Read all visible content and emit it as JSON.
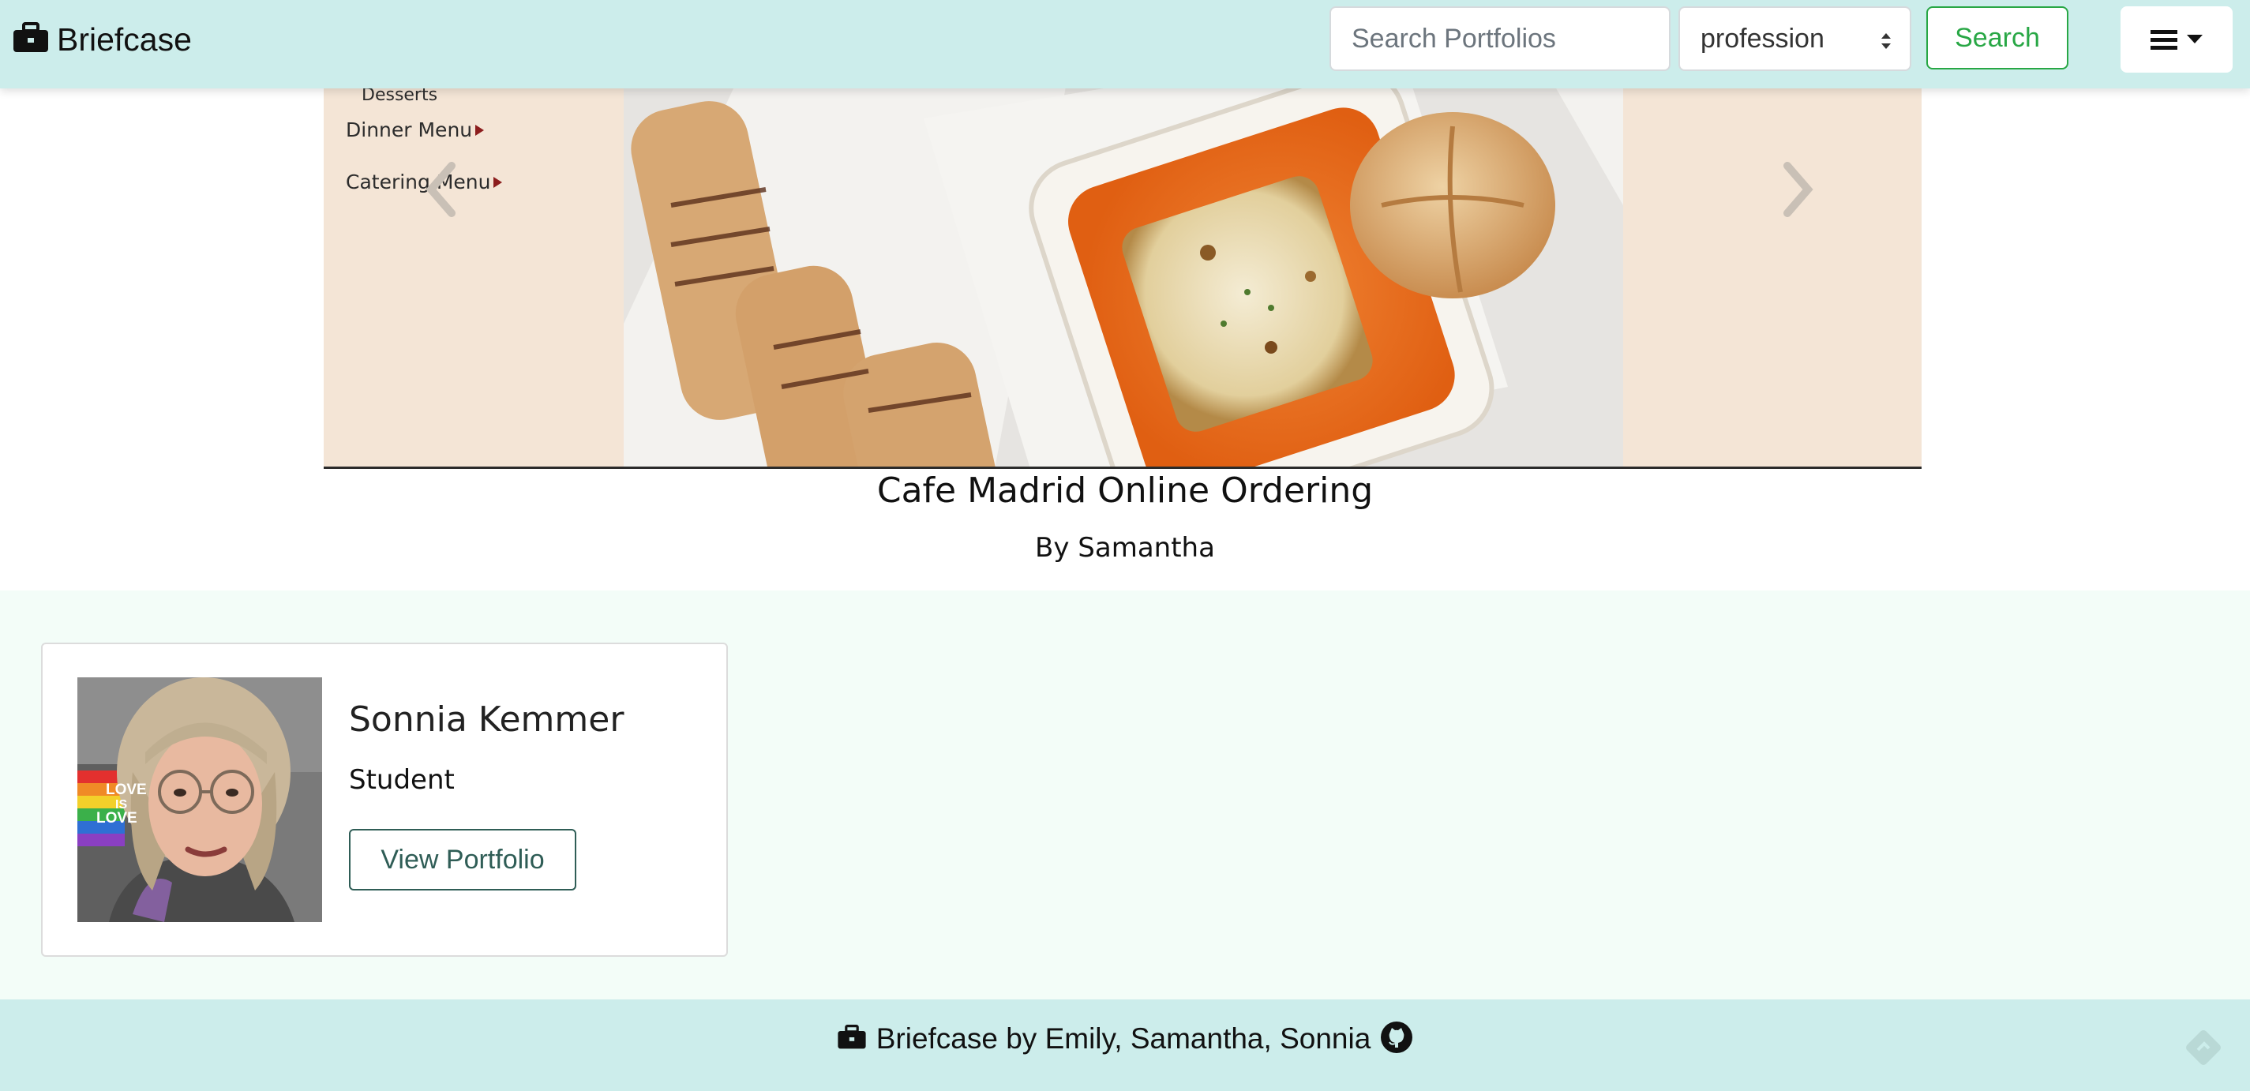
{
  "navbar": {
    "brand": "Briefcase",
    "brand_icon": "briefcase-icon",
    "search_placeholder": "Search Portfolios",
    "select_value": "profession",
    "search_button": "Search",
    "menu_icon": "hamburger-dropdown-icon"
  },
  "carousel": {
    "menu_items": [
      "Desserts",
      "Dinner Menu",
      "Catering Menu"
    ],
    "prev_icon": "chevron-left-icon",
    "next_icon": "chevron-right-icon",
    "title": "Cafe Madrid Online Ordering",
    "author": "By Samantha"
  },
  "profiles": [
    {
      "name": "Sonnia Kemmer",
      "role": "Student",
      "button": "View Portfolio",
      "avatar_text": [
        "LOVE",
        "IS",
        "LOVE"
      ]
    }
  ],
  "footer": {
    "text": "Briefcase by Emily, Samantha, Sonnia",
    "icons": [
      "briefcase-icon",
      "github-icon"
    ],
    "corner_icon": "feedback-icon"
  },
  "colors": {
    "navbar_bg": "#ccedeb",
    "search_green": "#28a745",
    "profiles_bg": "#f3fdf8",
    "panel_beige": "#f4e5d6"
  }
}
